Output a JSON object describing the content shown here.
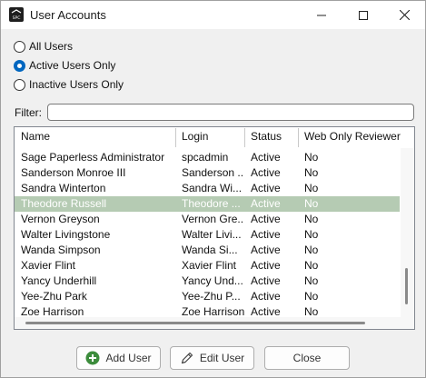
{
  "window": {
    "title": "User Accounts",
    "app_icon_text": "SPC"
  },
  "filter_options": [
    {
      "label": "All Users",
      "checked": false
    },
    {
      "label": "Active Users Only",
      "checked": true
    },
    {
      "label": "Inactive Users Only",
      "checked": false
    }
  ],
  "filter": {
    "label": "Filter:",
    "value": ""
  },
  "table": {
    "columns": [
      "Name",
      "Login",
      "Status",
      "Web Only Reviewer"
    ],
    "rows": [
      {
        "name": "Sage Paperless Administrator",
        "login": "spcadmin",
        "status": "Active",
        "web_only": "No",
        "selected": false
      },
      {
        "name": "Sanderson Monroe III",
        "login": "Sanderson ...",
        "status": "Active",
        "web_only": "No",
        "selected": false
      },
      {
        "name": "Sandra Winterton",
        "login": "Sandra Wi...",
        "status": "Active",
        "web_only": "No",
        "selected": false
      },
      {
        "name": "Theodore Russell",
        "login": "Theodore ...",
        "status": "Active",
        "web_only": "No",
        "selected": true
      },
      {
        "name": "Vernon Greyson",
        "login": "Vernon Gre...",
        "status": "Active",
        "web_only": "No",
        "selected": false
      },
      {
        "name": "Walter Livingstone",
        "login": "Walter Livi...",
        "status": "Active",
        "web_only": "No",
        "selected": false
      },
      {
        "name": "Wanda Simpson",
        "login": "Wanda Si...",
        "status": "Active",
        "web_only": "No",
        "selected": false
      },
      {
        "name": "Xavier Flint",
        "login": "Xavier Flint",
        "status": "Active",
        "web_only": "No",
        "selected": false
      },
      {
        "name": "Yancy Underhill",
        "login": "Yancy Und...",
        "status": "Active",
        "web_only": "No",
        "selected": false
      },
      {
        "name": "Yee-Zhu Park",
        "login": "Yee-Zhu P...",
        "status": "Active",
        "web_only": "No",
        "selected": false
      },
      {
        "name": "Zoe Harrison",
        "login": "Zoe Harrison",
        "status": "Active",
        "web_only": "No",
        "selected": false
      }
    ]
  },
  "buttons": {
    "add_user": "Add User",
    "edit_user": "Edit User",
    "close": "Close"
  },
  "colors": {
    "selection": "#b5cbb3",
    "radio_accent": "#0067c0",
    "add_icon": "#3c8c3c"
  }
}
